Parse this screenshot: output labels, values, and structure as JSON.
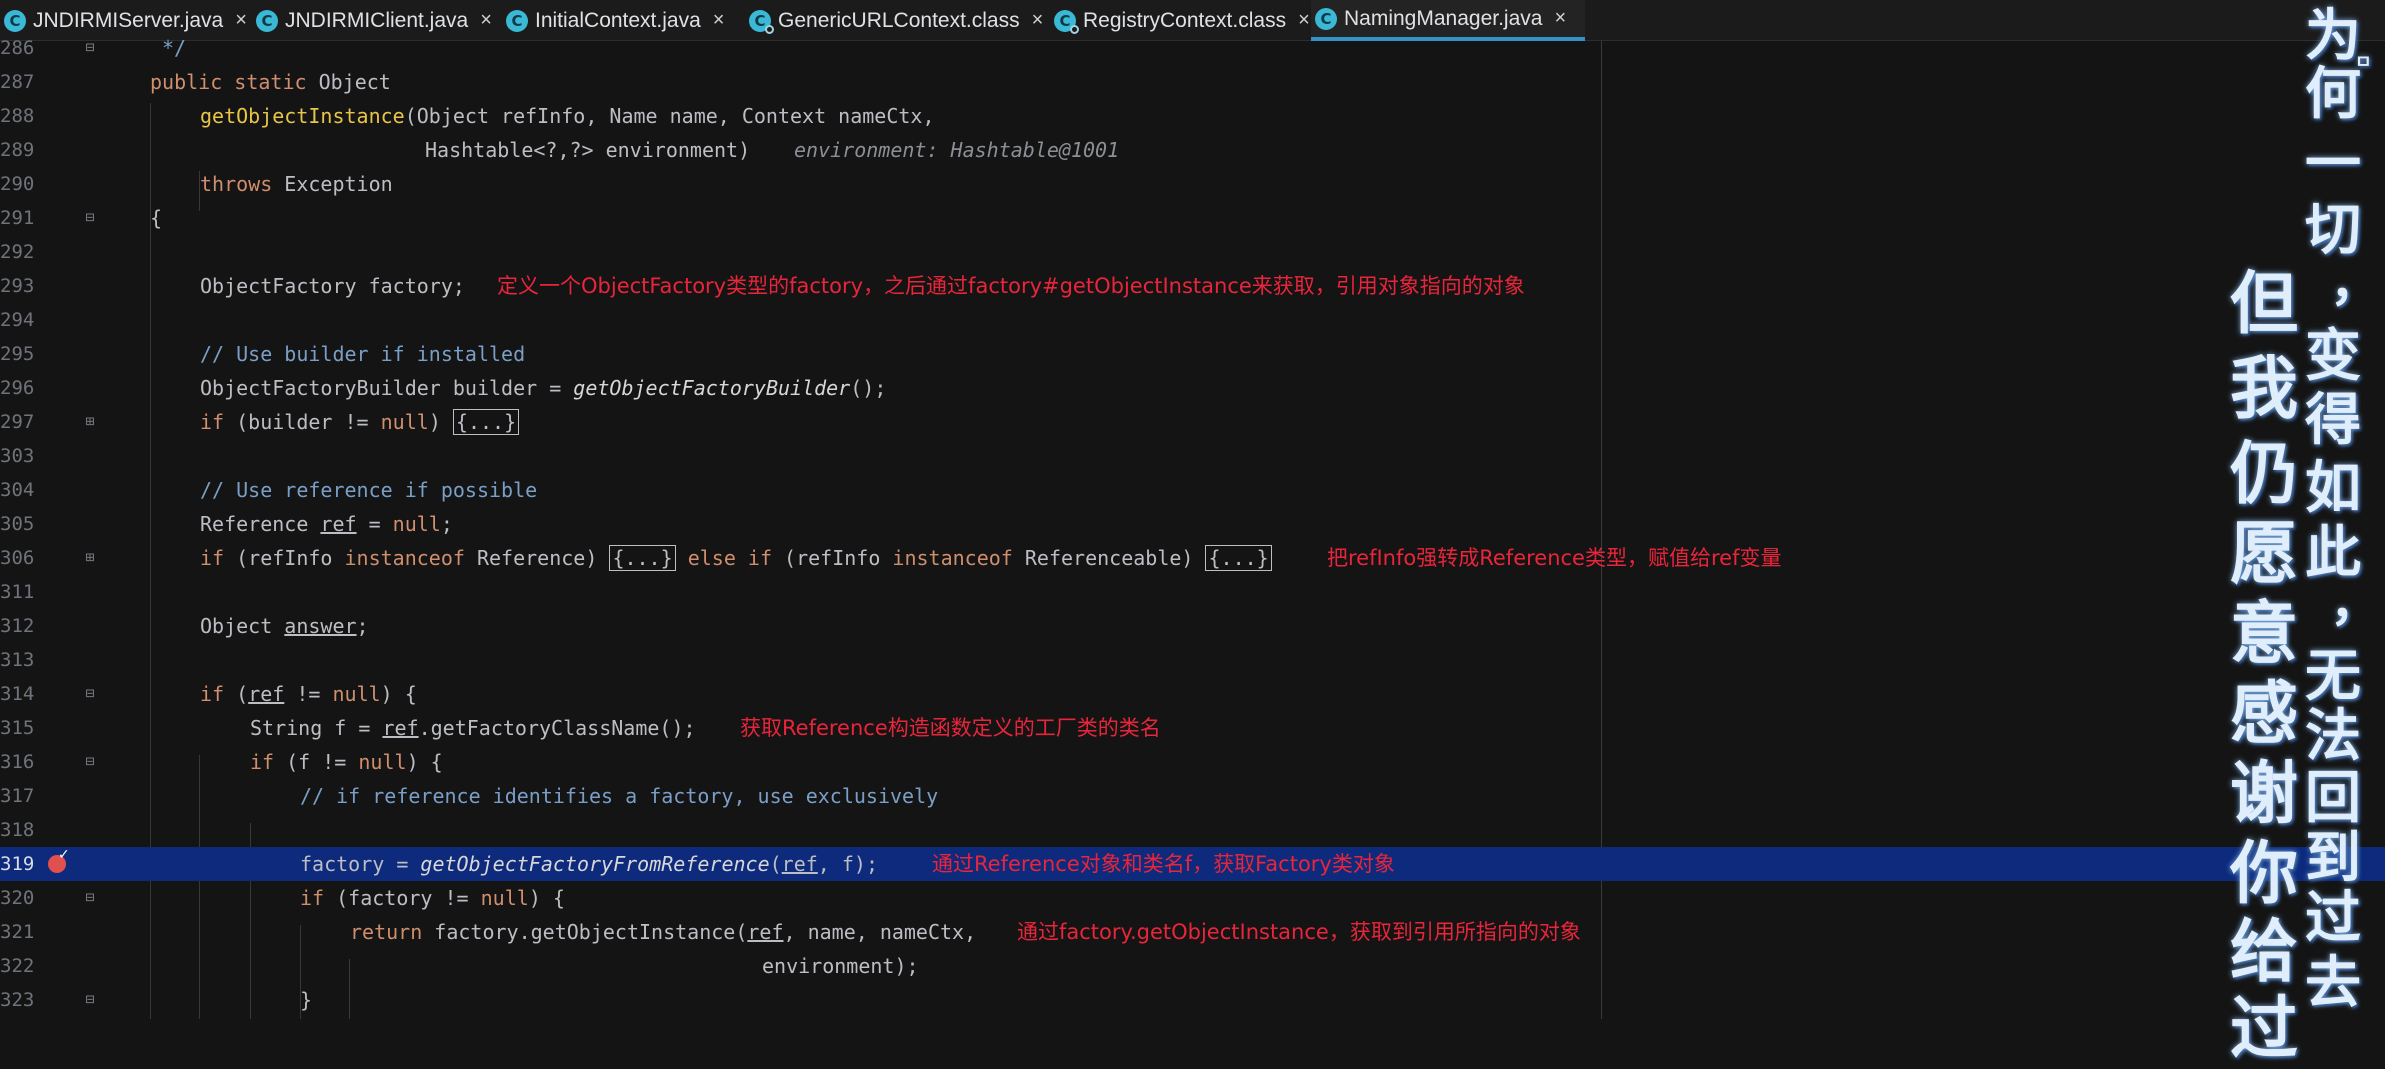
{
  "tabs": [
    {
      "label": "JNDIRMIServer.java",
      "icon": "java-class-icon",
      "active": false
    },
    {
      "label": "JNDIRMIClient.java",
      "icon": "java-class-icon",
      "active": false
    },
    {
      "label": "InitialContext.java",
      "icon": "java-class-icon",
      "active": false
    },
    {
      "label": "GenericURLContext.class",
      "icon": "compiled-class-icon",
      "active": false
    },
    {
      "label": "RegistryContext.class",
      "icon": "compiled-class-icon",
      "active": false
    },
    {
      "label": "NamingManager.java",
      "icon": "java-class-icon",
      "active": true
    }
  ],
  "close_glyph": "×",
  "tab_icon_letter": "C",
  "fold_placeholder": "{...}",
  "lines": [
    {
      "n": "286"
    },
    {
      "n": "287"
    },
    {
      "n": "288"
    },
    {
      "n": "289"
    },
    {
      "n": "290"
    },
    {
      "n": "291"
    },
    {
      "n": "292"
    },
    {
      "n": "293"
    },
    {
      "n": "294"
    },
    {
      "n": "295"
    },
    {
      "n": "296"
    },
    {
      "n": "297"
    },
    {
      "n": "303"
    },
    {
      "n": "304"
    },
    {
      "n": "305"
    },
    {
      "n": "306"
    },
    {
      "n": "311"
    },
    {
      "n": "312"
    },
    {
      "n": "313"
    },
    {
      "n": "314"
    },
    {
      "n": "315"
    },
    {
      "n": "316"
    },
    {
      "n": "317"
    },
    {
      "n": "318"
    },
    {
      "n": "319"
    },
    {
      "n": "320"
    },
    {
      "n": "321"
    },
    {
      "n": "322"
    },
    {
      "n": "323"
    }
  ],
  "code": {
    "l286": "*/",
    "l287_kw1": "public static",
    "l287_type": " Object",
    "l288_fn": "getObjectInstance",
    "l288_rest": "(Object refInfo, Name name, Context nameCtx,",
    "l289_code": "Hashtable<?,?> environment)",
    "l289_hint": "environment: Hashtable@1001",
    "l290_kw": "throws",
    "l290_rest": " Exception",
    "l291": "{",
    "l293": "ObjectFactory factory;",
    "l295": "// Use builder if installed",
    "l296_a": "ObjectFactoryBuilder builder = ",
    "l296_b": "getObjectFactoryBuilder",
    "l296_c": "();",
    "l297_a": "if",
    "l297_b": " (builder != ",
    "l297_c": "null",
    "l297_d": ") ",
    "l304": "// Use reference if possible",
    "l305_a": "Reference ",
    "l305_b": "ref",
    "l305_c": " = ",
    "l305_d": "null",
    "l305_e": ";",
    "l306_a": "if",
    "l306_b": " (refInfo ",
    "l306_c": "instanceof",
    "l306_d": " Reference) ",
    "l306_e": " else if",
    "l306_f": " (refInfo ",
    "l306_g": "instanceof",
    "l306_h": " Referenceable) ",
    "l312_a": "Object ",
    "l312_b": "answer",
    "l312_c": ";",
    "l314_a": "if",
    "l314_b": " (",
    "l314_c": "ref",
    "l314_d": " != ",
    "l314_e": "null",
    "l314_f": ") {",
    "l315_a": "String f = ",
    "l315_b": "ref",
    "l315_c": ".getFactoryClassName();",
    "l316_a": "if",
    "l316_b": " (f != ",
    "l316_c": "null",
    "l316_d": ") {",
    "l317": "// if reference identifies a factory, use exclusively",
    "l319_a": "factory = ",
    "l319_b": "getObjectFactoryFromReference",
    "l319_c": "(",
    "l319_d": "ref",
    "l319_e": ", f);",
    "l320_a": "if",
    "l320_b": " (factory != ",
    "l320_c": "null",
    "l320_d": ") {",
    "l321_a": "return",
    "l321_b": " factory.getObjectInstance(",
    "l321_c": "ref",
    "l321_d": ", name, nameCtx,",
    "l322": "environment);",
    "l323": "}"
  },
  "annotations": {
    "a293": "定义一个ObjectFactory类型的factory，之后通过factory#getObjectInstance来获取，引用对象指向的对象",
    "a306": "把refInfo强转成Reference类型，赋值给ref变量",
    "a315": "获取Reference构造函数定义的工厂类的类名",
    "a319": "通过Reference对象和类名f，获取Factory类对象",
    "a321": "通过factory.getObjectInstance，获取到引用所指向的对象"
  },
  "overlay": {
    "col1": [
      "为",
      "何",
      "一",
      "切",
      "，",
      "变",
      "得",
      "如",
      "此",
      "，",
      "无",
      "法",
      "回",
      "到",
      "过",
      "去"
    ],
    "col2": [
      "但",
      "我",
      "仍",
      "愿",
      "意",
      "感",
      "谢",
      "你",
      "给",
      "过"
    ],
    "small_mark": "ㅁ"
  },
  "colors": {
    "keyword": "#cf8e6d",
    "function": "#e7c547",
    "comment": "#7a9fc7",
    "annotation": "#e8253a",
    "current_line": "#0d2a7c",
    "tab_underline": "#3592c4",
    "tab_icon": "#3bb8d6",
    "breakpoint": "#e0504f"
  }
}
